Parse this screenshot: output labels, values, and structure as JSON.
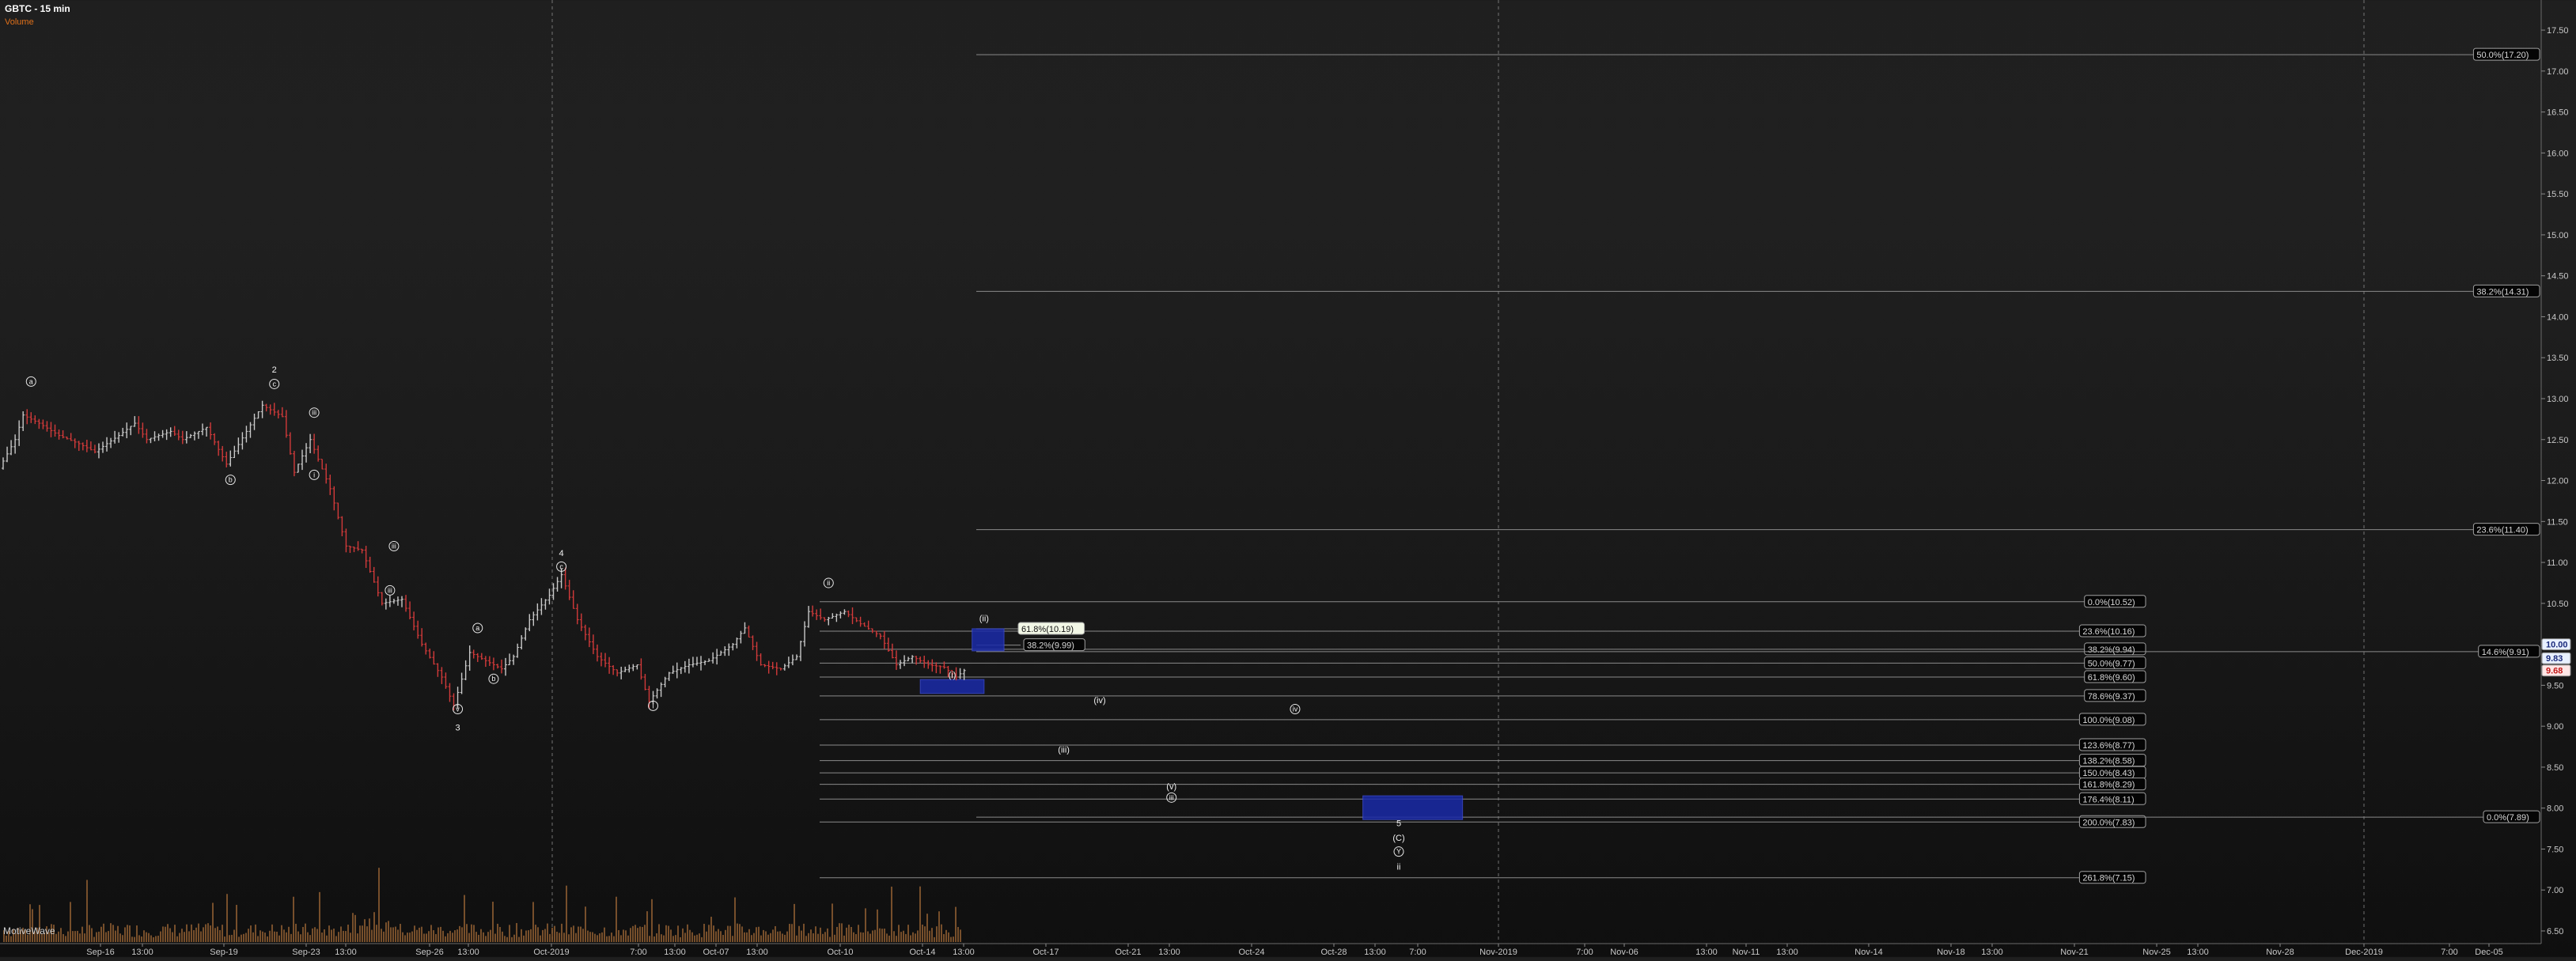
{
  "header": {
    "symbol_title": "GBTC - 15 min",
    "volume_label": "Volume"
  },
  "watermark": "MotiveWave",
  "colors": {
    "up_bar": "#c8c8c8",
    "down_bar": "#d23a3a",
    "fib_line": "#8a8a8a",
    "label_bg": "#050505",
    "box_fill": "#1a2aa8",
    "volume_fill": "#8a5a30",
    "price_box_blue": "#e8f0ff",
    "price_box_red": "#ffe6e6"
  },
  "chart_data": {
    "type": "line",
    "title": "GBTC - 15 min",
    "ylim": [
      6.5,
      17.8
    ],
    "y_ticks": [
      "17.50",
      "17.00",
      "16.50",
      "16.00",
      "15.50",
      "15.00",
      "14.50",
      "14.00",
      "13.50",
      "13.00",
      "12.50",
      "12.00",
      "11.50",
      "11.00",
      "10.50",
      "10.00",
      "9.50",
      "9.00",
      "8.50",
      "8.00",
      "7.50",
      "7.00",
      "6.50"
    ],
    "price_boxes": [
      {
        "text": "10.00",
        "value": 10.0,
        "style": "blue"
      },
      {
        "text": "9.83",
        "value": 9.83,
        "style": "blue"
      },
      {
        "text": "9.68",
        "value": 9.68,
        "style": "red"
      }
    ],
    "x_ticks": [
      "Sep-16",
      "13:00",
      "Sep-19",
      "Sep-23",
      "13:00",
      "Sep-26",
      "13:00",
      "Oct-2019",
      "7:00",
      "13:00",
      "Oct-07",
      "13:00",
      "Oct-10",
      "Oct-14",
      "13:00",
      "Oct-17",
      "Oct-21",
      "13:00",
      "Oct-24",
      "Oct-28",
      "13:00",
      "7:00",
      "Nov-2019",
      "7:00",
      "Nov-06",
      "13:00",
      "Nov-11",
      "13:00",
      "Nov-14",
      "Nov-18",
      "13:00",
      "Nov-21",
      "Nov-25",
      "13:00",
      "Nov-28",
      "Dec-2019",
      "7:00",
      "Dec-05"
    ],
    "price_series": [
      {
        "t": 0,
        "v": 12.15
      },
      {
        "t": 4,
        "v": 12.5
      },
      {
        "t": 6,
        "v": 12.8
      },
      {
        "t": 10,
        "v": 12.7
      },
      {
        "t": 15,
        "v": 12.55
      },
      {
        "t": 20,
        "v": 12.45
      },
      {
        "t": 24,
        "v": 12.35
      },
      {
        "t": 30,
        "v": 12.55
      },
      {
        "t": 34,
        "v": 12.7
      },
      {
        "t": 37,
        "v": 12.5
      },
      {
        "t": 43,
        "v": 12.6
      },
      {
        "t": 46,
        "v": 12.5
      },
      {
        "t": 52,
        "v": 12.65
      },
      {
        "t": 57,
        "v": 12.2
      },
      {
        "t": 62,
        "v": 12.6
      },
      {
        "t": 66,
        "v": 12.92
      },
      {
        "t": 71,
        "v": 12.78
      },
      {
        "t": 74,
        "v": 12.1
      },
      {
        "t": 78,
        "v": 12.5
      },
      {
        "t": 83,
        "v": 11.9
      },
      {
        "t": 87,
        "v": 11.2
      },
      {
        "t": 91,
        "v": 11.15
      },
      {
        "t": 96,
        "v": 10.5
      },
      {
        "t": 101,
        "v": 10.55
      },
      {
        "t": 106,
        "v": 10.0
      },
      {
        "t": 111,
        "v": 9.6
      },
      {
        "t": 114,
        "v": 9.25
      },
      {
        "t": 118,
        "v": 9.9
      },
      {
        "t": 122,
        "v": 9.8
      },
      {
        "t": 126,
        "v": 9.7
      },
      {
        "t": 129,
        "v": 9.85
      },
      {
        "t": 133,
        "v": 10.3
      },
      {
        "t": 138,
        "v": 10.6
      },
      {
        "t": 141,
        "v": 10.85
      },
      {
        "t": 145,
        "v": 10.3
      },
      {
        "t": 150,
        "v": 9.85
      },
      {
        "t": 155,
        "v": 9.65
      },
      {
        "t": 160,
        "v": 9.75
      },
      {
        "t": 163,
        "v": 9.3
      },
      {
        "t": 168,
        "v": 9.65
      },
      {
        "t": 173,
        "v": 9.75
      },
      {
        "t": 178,
        "v": 9.8
      },
      {
        "t": 184,
        "v": 10.0
      },
      {
        "t": 187,
        "v": 10.2
      },
      {
        "t": 191,
        "v": 9.75
      },
      {
        "t": 196,
        "v": 9.7
      },
      {
        "t": 200,
        "v": 9.85
      },
      {
        "t": 203,
        "v": 10.4
      },
      {
        "t": 207,
        "v": 10.3
      },
      {
        "t": 212,
        "v": 10.4
      },
      {
        "t": 216,
        "v": 10.25
      },
      {
        "t": 221,
        "v": 10.1
      },
      {
        "t": 225,
        "v": 9.75
      },
      {
        "t": 229,
        "v": 9.85
      },
      {
        "t": 233,
        "v": 9.75
      },
      {
        "t": 237,
        "v": 9.72
      },
      {
        "t": 240,
        "v": 9.6
      },
      {
        "t": 242,
        "v": 9.68
      }
    ],
    "fib_levels_left": [
      {
        "label": "0.0%(10.52)",
        "value": 10.52
      },
      {
        "label": "23.6%(10.16)",
        "value": 10.16
      },
      {
        "label": "38.2%(9.94)",
        "value": 9.94
      },
      {
        "label": "50.0%(9.77)",
        "value": 9.77
      },
      {
        "label": "61.8%(9.60)",
        "value": 9.6
      },
      {
        "label": "78.6%(9.37)",
        "value": 9.37
      },
      {
        "label": "100.0%(9.08)",
        "value": 9.08
      },
      {
        "label": "123.6%(8.77)",
        "value": 8.77
      },
      {
        "label": "138.2%(8.58)",
        "value": 8.58
      },
      {
        "label": "150.0%(8.43)",
        "value": 8.43
      },
      {
        "label": "161.8%(8.29)",
        "value": 8.29
      },
      {
        "label": "176.4%(8.11)",
        "value": 8.11
      },
      {
        "label": "200.0%(7.83)",
        "value": 7.83
      },
      {
        "label": "261.8%(7.15)",
        "value": 7.15
      }
    ],
    "fib_levels_right": [
      {
        "label": "50.0%(17.20)",
        "value": 17.2
      },
      {
        "label": "38.2%(14.31)",
        "value": 14.31
      },
      {
        "label": "23.6%(11.40)",
        "value": 11.4
      },
      {
        "label": "14.6%(9.91)",
        "value": 9.91
      },
      {
        "label": "0.0%(7.89)",
        "value": 7.89
      }
    ],
    "fib_short": [
      {
        "label": "61.8%(10.19)",
        "value": 10.19,
        "highlight": true
      },
      {
        "label": "38.2%(9.99)",
        "value": 9.99,
        "highlight": false
      }
    ],
    "target_boxes": [
      {
        "name": "box-ii",
        "t0": 243,
        "t1": 251,
        "top": 10.19,
        "bottom": 9.92
      },
      {
        "name": "box-i",
        "t0": 230,
        "t1": 246,
        "top": 9.57,
        "bottom": 9.4
      },
      {
        "name": "box-5",
        "t0": 341,
        "t1": 366,
        "top": 8.15,
        "bottom": 7.86
      }
    ],
    "wave_labels": [
      {
        "text": "a",
        "t": 7,
        "v": 13.18,
        "circle": true
      },
      {
        "text": "2",
        "t": 68,
        "v": 13.32,
        "circle": false
      },
      {
        "text": "c",
        "t": 68,
        "v": 13.15,
        "circle": true
      },
      {
        "text": "b",
        "t": 57,
        "v": 11.98,
        "circle": true
      },
      {
        "text": "iii",
        "t": 78,
        "v": 12.8,
        "circle": true
      },
      {
        "text": "i",
        "t": 78,
        "v": 12.04,
        "circle": true
      },
      {
        "text": "iii",
        "t": 98,
        "v": 11.17,
        "circle": true
      },
      {
        "text": "iii",
        "t": 97,
        "v": 10.63,
        "circle": true
      },
      {
        "text": "4",
        "t": 140,
        "v": 11.08,
        "circle": false
      },
      {
        "text": "c",
        "t": 140,
        "v": 10.92,
        "circle": true
      },
      {
        "text": "a",
        "t": 119,
        "v": 10.17,
        "circle": true
      },
      {
        "text": "b",
        "t": 123,
        "v": 9.55,
        "circle": true
      },
      {
        "text": "v",
        "t": 114,
        "v": 9.18,
        "circle": true
      },
      {
        "text": "3",
        "t": 114,
        "v": 8.95,
        "circle": false
      },
      {
        "text": "i",
        "t": 163,
        "v": 9.22,
        "circle": true
      },
      {
        "text": "ii",
        "t": 207,
        "v": 10.72,
        "circle": true
      },
      {
        "text": "(ii)",
        "t": 246,
        "v": 10.28,
        "circle": false
      },
      {
        "text": "(i)",
        "t": 238,
        "v": 9.59,
        "circle": false
      },
      {
        "text": "(iv)",
        "t": 275,
        "v": 9.28,
        "circle": false
      },
      {
        "text": "iv",
        "t": 324,
        "v": 9.18,
        "circle": true
      },
      {
        "text": "(iii)",
        "t": 266,
        "v": 8.68,
        "circle": false
      },
      {
        "text": "(v)",
        "t": 293,
        "v": 8.23,
        "circle": false
      },
      {
        "text": "iii",
        "t": 293,
        "v": 8.1,
        "circle": true
      },
      {
        "text": "5",
        "t": 350,
        "v": 7.78,
        "circle": false
      },
      {
        "text": "(C)",
        "t": 350,
        "v": 7.6,
        "circle": false
      },
      {
        "text": "Y",
        "t": 350,
        "v": 7.44,
        "circle": true
      },
      {
        "text": "ii",
        "t": 350,
        "v": 7.25,
        "circle": false
      }
    ]
  }
}
